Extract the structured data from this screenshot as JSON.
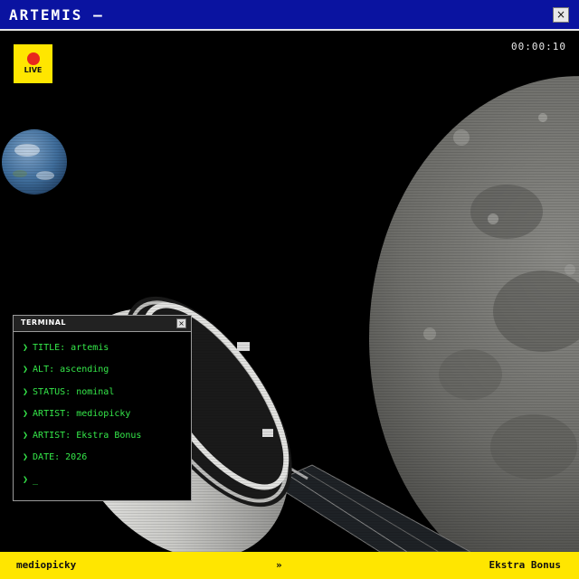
{
  "window": {
    "title": "ARTEMIS —",
    "close_symbol": "×"
  },
  "overlay": {
    "live_label": "LIVE",
    "timer": "00:00:10"
  },
  "terminal": {
    "title": "TERMINAL",
    "close_symbol": "×",
    "prompt": "❯",
    "lines": [
      "TITLE: artemis",
      "ALT: ascending",
      "STATUS: nominal",
      "ARTIST: mediopicky",
      "ARTIST: Ekstra Bonus",
      "DATE: 2026"
    ],
    "cursor": "_"
  },
  "footer": {
    "left": "mediopicky",
    "separator": "»",
    "right": "Ekstra Bonus"
  },
  "colors": {
    "title_bar": "#0a13a0",
    "accent_yellow": "#ffe600",
    "live_red": "#e8271d",
    "terminal_green": "#35e84a"
  },
  "icons": [
    "close-icon",
    "live-dot-icon",
    "prompt-chevron-icon"
  ]
}
